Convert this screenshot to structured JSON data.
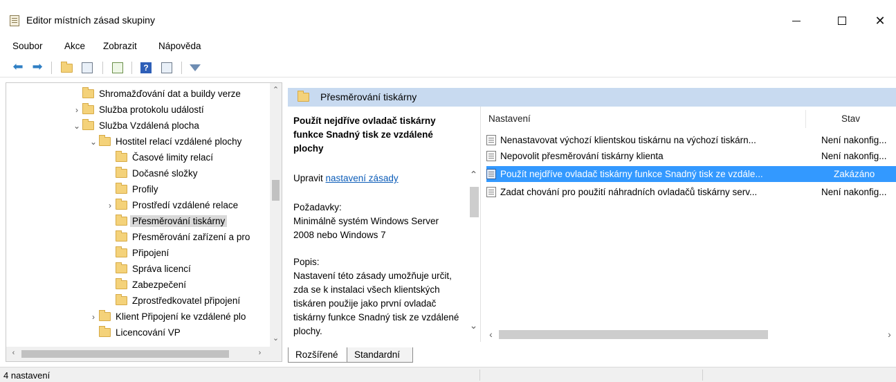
{
  "window": {
    "title": "Editor místních zásad skupiny",
    "minimize": "–",
    "maximize": "",
    "close": "✕"
  },
  "menu": [
    "Soubor",
    "Akce",
    "Zobrazit",
    "Nápověda"
  ],
  "toolbar": {
    "icons": [
      "back-arrow-icon",
      "forward-arrow-icon",
      "up-folder-icon",
      "show-hide-tree-icon",
      "export-list-icon",
      "help-icon",
      "properties-icon",
      "filter-icon"
    ]
  },
  "tree": {
    "items": [
      {
        "label": "Shromažďování dat a buildy verze",
        "expander": ""
      },
      {
        "label": "Služba protokolu událostí",
        "expander": "›"
      },
      {
        "label": "Služba Vzdálená plocha",
        "expander": "⌄"
      },
      {
        "label": "Hostitel relací vzdálené plochy",
        "expander": "⌄"
      },
      {
        "label": "Časové limity relací",
        "expander": ""
      },
      {
        "label": "Dočasné složky",
        "expander": ""
      },
      {
        "label": "Profily",
        "expander": ""
      },
      {
        "label": "Prostředí vzdálené relace",
        "expander": "›"
      },
      {
        "label": "Přesměrování tiskárny",
        "expander": ""
      },
      {
        "label": "Přesměrování zařízení a pro",
        "expander": ""
      },
      {
        "label": "Připojení",
        "expander": ""
      },
      {
        "label": "Správa licencí",
        "expander": ""
      },
      {
        "label": "Zabezpečení",
        "expander": ""
      },
      {
        "label": "Zprostředkovatel připojení",
        "expander": ""
      },
      {
        "label": "Klient Připojení ke vzdálené plo",
        "expander": "›"
      },
      {
        "label": "Licencování VP",
        "expander": ""
      }
    ]
  },
  "header": {
    "title": "Přesměrování tiskárny"
  },
  "description": {
    "policy_title": "Použít nejdříve ovladač tiskárny funkce Snadný tisk ze vzdálené plochy",
    "edit_prefix": "Upravit ",
    "edit_link": "nastavení zásady",
    "requirements": "Požadavky:\nMinimálně systém Windows Server 2008 nebo Windows 7",
    "popis": "Popis:\nNastavení této zásady umožňuje určit, zda se k instalaci všech klientských tiskáren použije jako první ovladač tiskárny funkce Snadný tisk ze vzdálené plochy."
  },
  "list": {
    "col_setting": "Nastavení",
    "col_state": "Stav",
    "rows": [
      {
        "name": "Nenastavovat výchozí klientskou tiskárnu na výchozí tiskárn...",
        "state": "Není nakonfig..."
      },
      {
        "name": "Nepovolit přesměrování tiskárny klienta",
        "state": "Není nakonfig..."
      },
      {
        "name": "Použít nejdříve ovladač tiskárny funkce Snadný tisk ze vzdále...",
        "state": "Zakázáno"
      },
      {
        "name": "Zadat chování pro použití náhradních ovladačů tiskárny serv...",
        "state": "Není nakonfig..."
      }
    ]
  },
  "tabs": [
    "Rozšířené",
    "Standardní"
  ],
  "status": {
    "text": "4 nastavení"
  }
}
